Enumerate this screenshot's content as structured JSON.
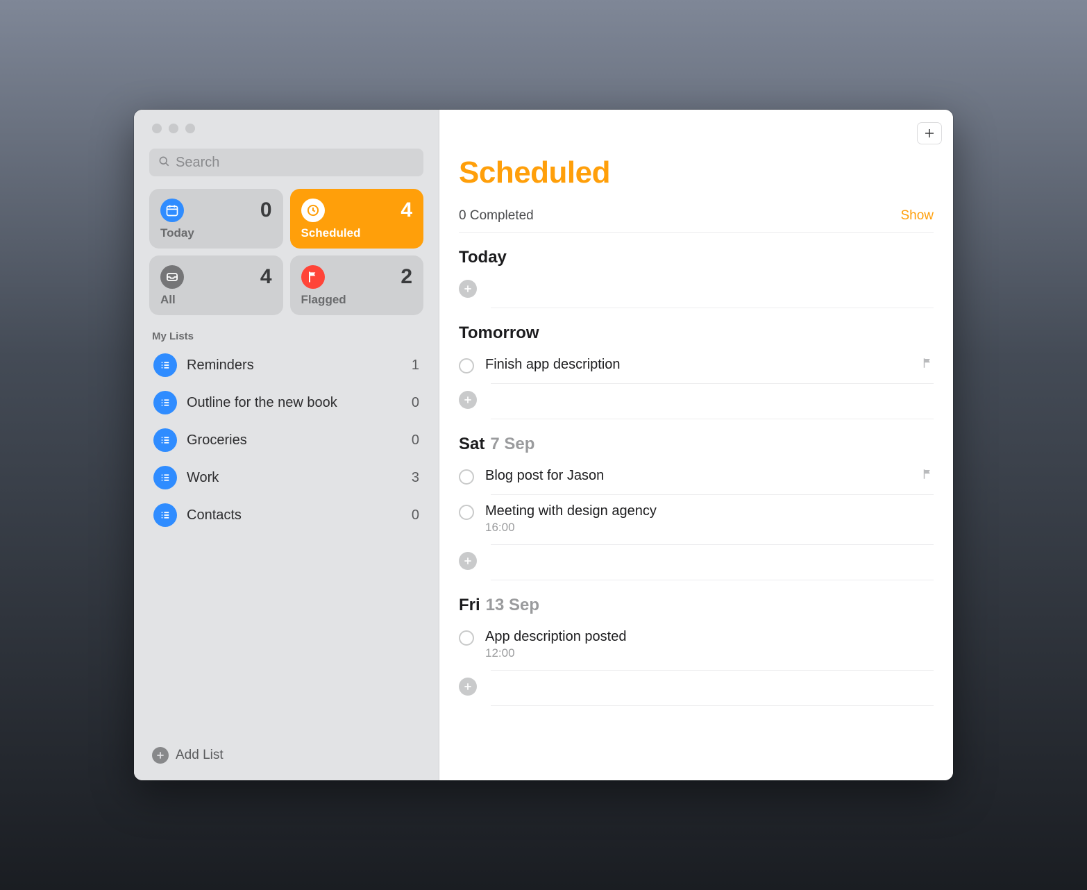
{
  "accent": "#ff9f0a",
  "sidebar": {
    "search_placeholder": "Search",
    "section": "My Lists",
    "add_list": "Add List",
    "pills": [
      {
        "key": "today",
        "label": "Today",
        "count": 0,
        "icon": "calendar",
        "color": "blue",
        "selected": false
      },
      {
        "key": "scheduled",
        "label": "Scheduled",
        "count": 4,
        "icon": "clock",
        "color": "white",
        "selected": true
      },
      {
        "key": "all",
        "label": "All",
        "count": 4,
        "icon": "tray",
        "color": "gray",
        "selected": false
      },
      {
        "key": "flagged",
        "label": "Flagged",
        "count": 2,
        "icon": "flag",
        "color": "red",
        "selected": false
      }
    ],
    "lists": [
      {
        "name": "Reminders",
        "count": 1
      },
      {
        "name": "Outline for the new book",
        "count": 0
      },
      {
        "name": "Groceries",
        "count": 0
      },
      {
        "name": "Work",
        "count": 3
      },
      {
        "name": "Contacts",
        "count": 0
      }
    ]
  },
  "main": {
    "title": "Scheduled",
    "completed_text": "0 Completed",
    "show_label": "Show",
    "groups": [
      {
        "head1": "Today",
        "head2": "",
        "items": []
      },
      {
        "head1": "Tomorrow",
        "head2": "",
        "items": [
          {
            "title": "Finish app description",
            "sub": "",
            "flagged": true
          }
        ]
      },
      {
        "head1": "Sat",
        "head2": "7 Sep",
        "items": [
          {
            "title": "Blog post for Jason",
            "sub": "",
            "flagged": true
          },
          {
            "title": "Meeting with design agency",
            "sub": "16:00",
            "flagged": false
          }
        ]
      },
      {
        "head1": "Fri",
        "head2": "13 Sep",
        "items": [
          {
            "title": "App description posted",
            "sub": "12:00",
            "flagged": false
          }
        ]
      }
    ]
  }
}
